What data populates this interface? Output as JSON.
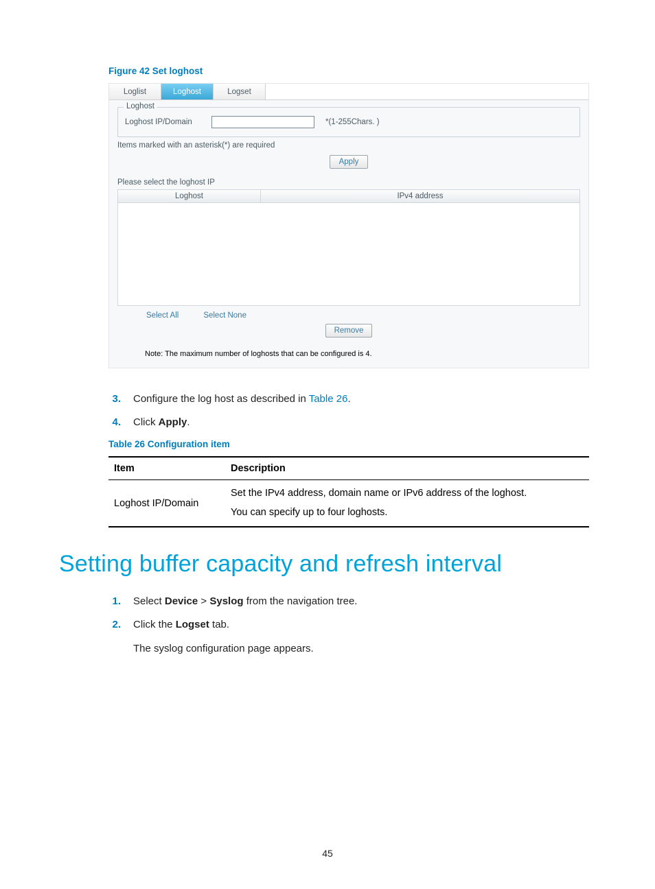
{
  "figure": {
    "caption": "Figure 42 Set loghost",
    "panel": {
      "tabs": [
        "Loglist",
        "Loghost",
        "Logset"
      ],
      "active_tab_index": 1,
      "fieldset_legend": "Loghost",
      "field_label": "Loghost IP/Domain",
      "input_value": "",
      "hint": "*(1-255Chars. )",
      "required_note": "Items marked with an asterisk(*) are required",
      "apply_label": "Apply",
      "select_caption": "Please select the loghost IP",
      "grid_col1": "Loghost",
      "grid_col2": "IPv4 address",
      "select_all": "Select All",
      "select_none": "Select None",
      "remove_label": "Remove",
      "note": "Note: The maximum number of loghosts that can be configured is 4."
    }
  },
  "instructions1": [
    {
      "num": "3.",
      "pre": "Configure the log host as described in ",
      "link": "Table 26",
      "post": "."
    },
    {
      "num": "4.",
      "pre": "Click ",
      "bold": "Apply",
      "post": "."
    }
  ],
  "table26": {
    "caption": "Table 26 Configuration item",
    "header_item": "Item",
    "header_desc": "Description",
    "row_item": "Loghost IP/Domain",
    "row_desc_line1": "Set the IPv4 address, domain name or IPv6 address of the loghost.",
    "row_desc_line2": "You can specify up to four loghosts."
  },
  "heading": "Setting buffer capacity and refresh interval",
  "instructions2": [
    {
      "num": "1.",
      "pre": "Select ",
      "bold1": "Device",
      "mid": " > ",
      "bold2": "Syslog",
      "post": " from the navigation tree."
    },
    {
      "num": "2.",
      "pre": "Click the ",
      "bold": "Logset",
      "post": " tab.",
      "sub": "The syslog configuration page appears."
    }
  ],
  "page_number": "45"
}
